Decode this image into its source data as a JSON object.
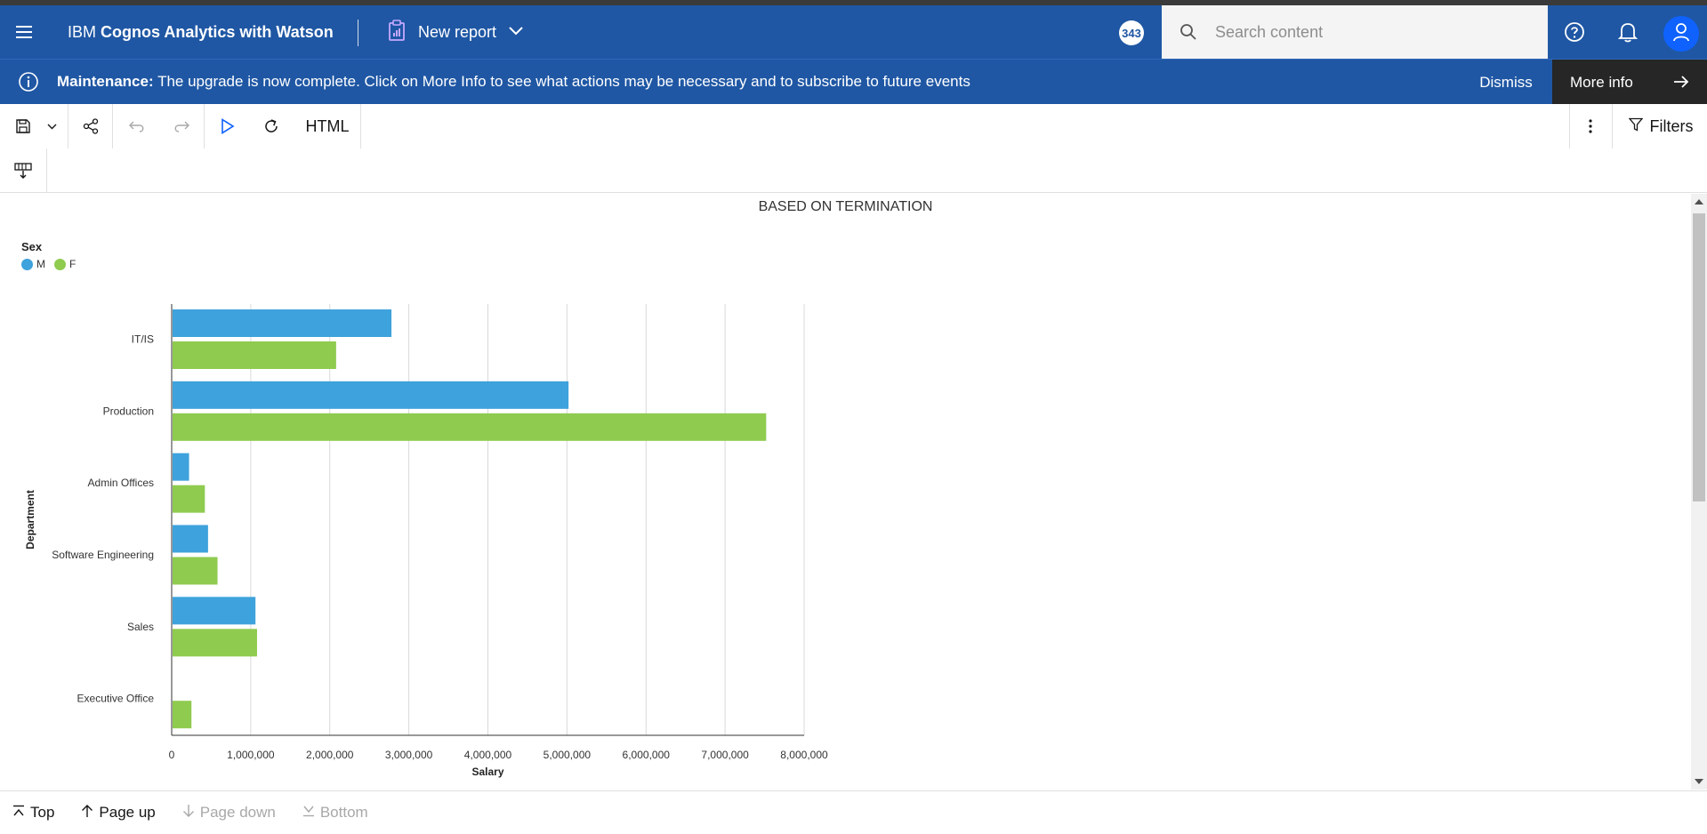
{
  "header": {
    "brand_prefix": "IBM",
    "brand_name": "Cognos Analytics with Watson",
    "report_label": "New report",
    "notification_count": "343",
    "search_placeholder": "Search content"
  },
  "banner": {
    "label": "Maintenance:",
    "message": "The upgrade is now complete. Click on More Info to see what actions may be necessary and to subscribe to future events",
    "dismiss": "Dismiss",
    "more_info": "More info"
  },
  "toolbar": {
    "output_format": "HTML",
    "filters_label": "Filters"
  },
  "pagenav": {
    "top": "Top",
    "page_up": "Page up",
    "page_down": "Page down",
    "bottom": "Bottom"
  },
  "chart_data": {
    "type": "bar",
    "orientation": "horizontal",
    "title": "BASED ON TERMINATION",
    "legend_title": "Sex",
    "categories": [
      "IT/IS",
      "Production",
      "Admin Offices",
      "Software Engineering",
      "Sales",
      "Executive Office"
    ],
    "series": [
      {
        "name": "M",
        "color": "#3ea2dc",
        "values": [
          2780000,
          5020000,
          220000,
          460000,
          1060000,
          0
        ]
      },
      {
        "name": "F",
        "color": "#8fcb4f",
        "values": [
          2080000,
          7520000,
          420000,
          580000,
          1080000,
          250000
        ]
      }
    ],
    "xlabel": "Salary",
    "ylabel": "Department",
    "xlim": [
      0,
      8000000
    ],
    "xticks": [
      0,
      1000000,
      2000000,
      3000000,
      4000000,
      5000000,
      6000000,
      7000000,
      8000000
    ],
    "xtick_labels": [
      "0",
      "1,000,000",
      "2,000,000",
      "3,000,000",
      "4,000,000",
      "5,000,000",
      "6,000,000",
      "7,000,000",
      "8,000,000"
    ],
    "grid": true,
    "legend_position": "top-left"
  },
  "colors": {
    "header_bg": "#1f57a4",
    "more_info_bg": "#262626",
    "series_m": "#3ea2dc",
    "series_f": "#8fcb4f"
  }
}
